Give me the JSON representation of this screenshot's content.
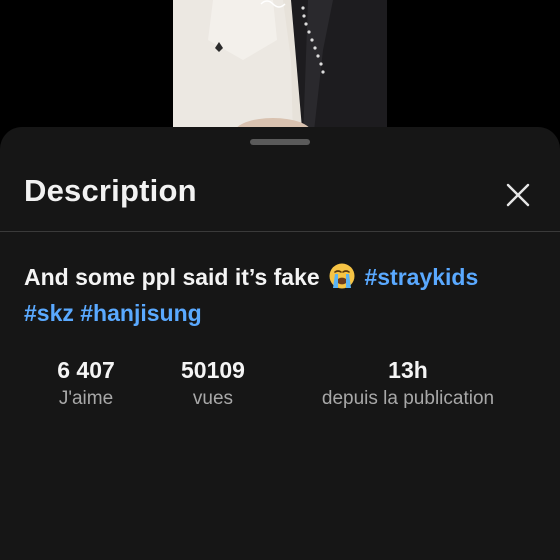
{
  "sheet": {
    "title": "Description",
    "close_icon": "close-icon"
  },
  "caption": {
    "text": "And some ppl said it’s fake",
    "emoji": "loudly-crying-face-emoji",
    "hashtags": [
      "#straykids",
      "#skz",
      "#hanjisung"
    ]
  },
  "stats": {
    "likes": {
      "value": "6 407",
      "label": "J'aime"
    },
    "views": {
      "value": "50109",
      "label": "vues"
    },
    "posted": {
      "value": "13h",
      "label": "depuis la publication"
    }
  },
  "colors": {
    "background": "#000000",
    "sheet": "#161616",
    "hashtag": "#5aa9ff",
    "text": "#f4f4f4",
    "muted": "#a8a8a8"
  }
}
